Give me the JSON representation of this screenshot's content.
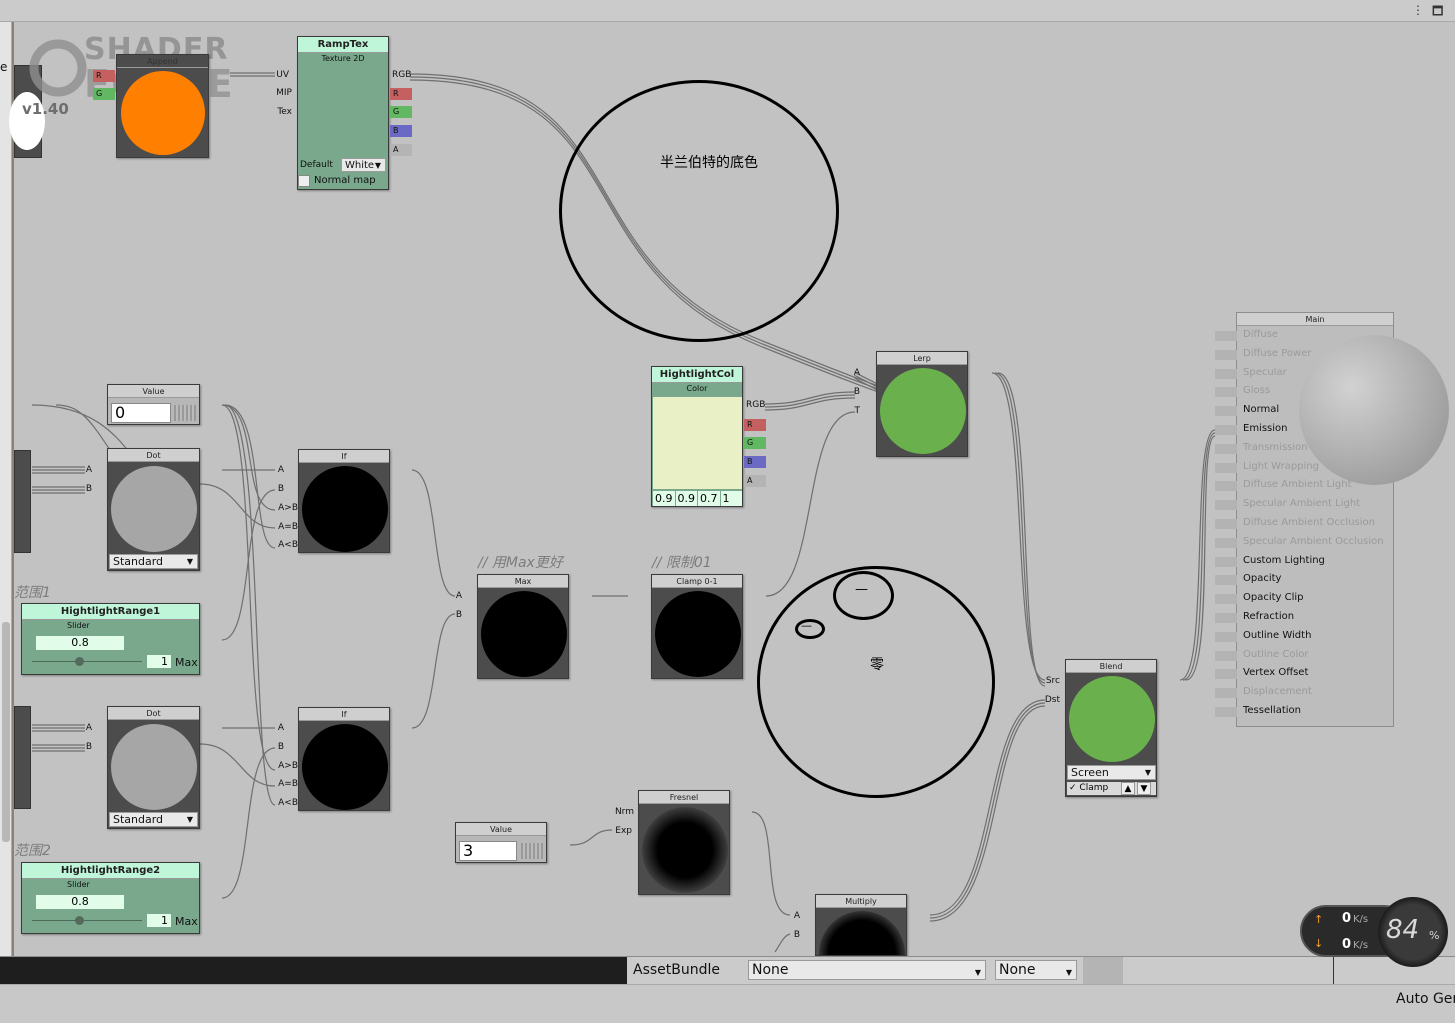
{
  "logo": {
    "line1": "SHADER",
    "line2": "FORGE",
    "version": "v1.40"
  },
  "nodes": {
    "append": {
      "title": "Append",
      "ports_in": [
        "R",
        "G"
      ]
    },
    "ramptex": {
      "title": "RampTex",
      "subtitle": "Texture 2D",
      "ports_in": [
        "UV",
        "MIP",
        "Tex"
      ],
      "ports_out": [
        "RGB",
        "R",
        "G",
        "B",
        "A"
      ],
      "default_label": "Default",
      "default_value": "White",
      "normal_map_label": "Normal map"
    },
    "value1": {
      "title": "Value",
      "value": "0"
    },
    "dot1": {
      "title": "Dot",
      "ports_in": [
        "A",
        "B"
      ],
      "mode": "Standard"
    },
    "if1": {
      "title": "If",
      "ports_in": [
        "A",
        "B",
        "A>B",
        "A=B",
        "A<B"
      ]
    },
    "range1": {
      "title": "HightlightRange1",
      "subtitle": "Slider",
      "value": "0.8",
      "min": "0",
      "max": "1",
      "max_label": "Max"
    },
    "dot2": {
      "title": "Dot",
      "ports_in": [
        "A",
        "B"
      ],
      "mode": "Standard"
    },
    "if2": {
      "title": "If",
      "ports_in": [
        "A",
        "B",
        "A>B",
        "A=B",
        "A<B"
      ]
    },
    "range2": {
      "title": "HightlightRange2",
      "subtitle": "Slider",
      "value": "0.8",
      "min": "0",
      "max": "1",
      "max_label": "Max"
    },
    "max": {
      "title": "Max",
      "ports_in": [
        "A",
        "B"
      ]
    },
    "clamp": {
      "title": "Clamp 0-1"
    },
    "hightlightcol": {
      "title": "HightlightCol",
      "subtitle": "Color",
      "ports_out": [
        "RGB",
        "R",
        "G",
        "B",
        "A"
      ],
      "rgba": [
        "0.9",
        "0.9",
        "0.7",
        "1"
      ],
      "swatch": "#e9f0c6"
    },
    "lerp": {
      "title": "Lerp",
      "ports_in": [
        "A",
        "B",
        "T"
      ]
    },
    "value2": {
      "title": "Value",
      "value": "3"
    },
    "fresnel": {
      "title": "Fresnel",
      "ports_in": [
        "Nrm",
        "Exp"
      ]
    },
    "multiply": {
      "title": "Multiply",
      "ports_in": [
        "A",
        "B"
      ]
    },
    "blend": {
      "title": "Blend",
      "ports_in": [
        "Src",
        "Dst"
      ],
      "mode": "Screen",
      "clamp_label": "Clamp"
    }
  },
  "comments": {
    "max_note": "// 用Max更好",
    "clamp_note": "// 限制01",
    "range1_cut": "范围1",
    "range2_cut": "范围2",
    "left_cut": "e",
    "left_cut2": "0"
  },
  "annotations": {
    "circle1": "半兰伯特的底色",
    "circle2": "零",
    "face_mark1": "—",
    "face_mark2": "—"
  },
  "main": {
    "title": "Main",
    "items": [
      {
        "label": "Diffuse",
        "active": false
      },
      {
        "label": "Diffuse Power",
        "active": false
      },
      {
        "label": "Specular",
        "active": false
      },
      {
        "label": "Gloss",
        "active": false
      },
      {
        "label": "Normal",
        "active": true
      },
      {
        "label": "Emission",
        "active": true
      },
      {
        "label": "Transmission",
        "active": false
      },
      {
        "label": "Light Wrapping",
        "active": false
      },
      {
        "label": "Diffuse Ambient Light",
        "active": false
      },
      {
        "label": "Specular Ambient Light",
        "active": false
      },
      {
        "label": "Diffuse Ambient Occlusion",
        "active": false
      },
      {
        "label": "Specular Ambient Occlusion",
        "active": false
      },
      {
        "label": "Custom Lighting",
        "active": true
      },
      {
        "label": "Opacity",
        "active": true
      },
      {
        "label": "Opacity Clip",
        "active": true
      },
      {
        "label": "Refraction",
        "active": true
      },
      {
        "label": "Outline Width",
        "active": true
      },
      {
        "label": "Outline Color",
        "active": false
      },
      {
        "label": "Vertex Offset",
        "active": true
      },
      {
        "label": "Displacement",
        "active": false
      },
      {
        "label": "Tessellation",
        "active": true
      }
    ]
  },
  "bottom": {
    "assetbundle_label": "AssetBundle",
    "bundle_value": "None",
    "variant_value": "None",
    "auto_gen": "Auto Ger"
  },
  "network": {
    "up": "0",
    "down": "0",
    "unit": "K/s",
    "percent": "84",
    "percent_sign": "%"
  },
  "colors": {
    "orange": "#ff7f00",
    "green": "#6ab04c",
    "black": "#000000",
    "gray": "#a6a6a6",
    "red_port": "#c46060",
    "green_port": "#62b862",
    "blue_port": "#6a6ac4"
  }
}
